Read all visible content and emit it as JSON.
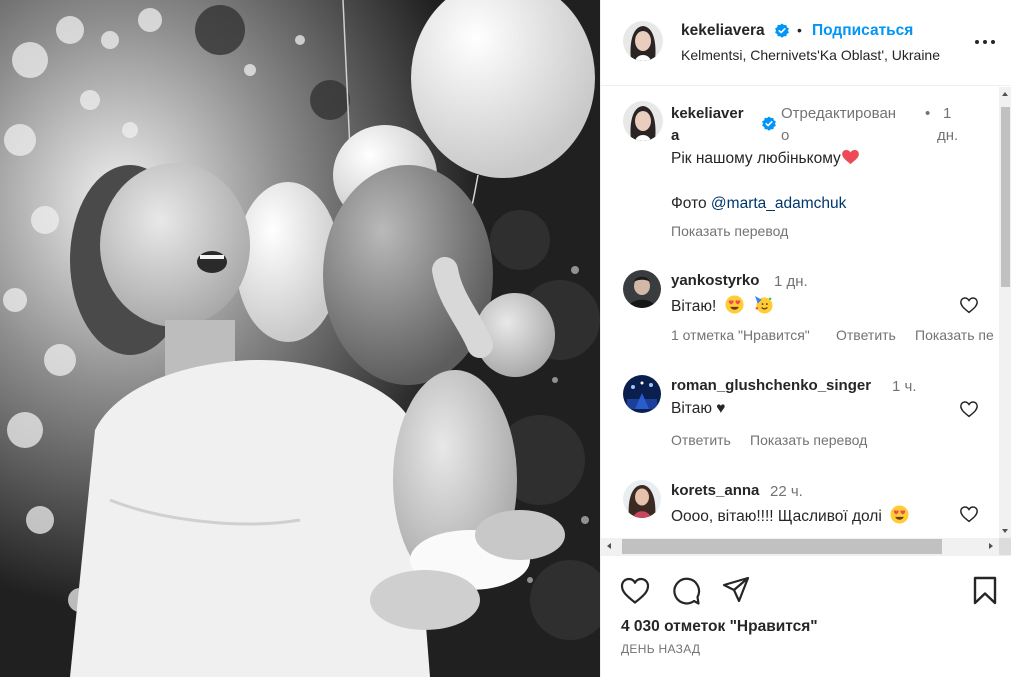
{
  "post": {
    "author": "kekeliavera",
    "follow_label": "Подписаться",
    "separator": "•",
    "location": "Kelmentsi, Chernivets'Ka Oblast', Ukraine",
    "caption": {
      "author_line1": "kekeliaver",
      "author_line2": "a",
      "edited_line1": "Отредактирован",
      "edited_line2": "о",
      "separator": "•",
      "time_line1": "1",
      "time_line2": "дн.",
      "text": "Рік нашому любінькому",
      "photo_prefix": "Фото ",
      "photo_mention": "@marta_adamchuk",
      "translate_label": "Показать перевод"
    }
  },
  "comments": [
    {
      "user": "yankostyrko",
      "time": "1 дн.",
      "text": "Вітаю!",
      "emojis": [
        "smiling-face-with-heart-eyes",
        "partying-face"
      ],
      "likes_label": "1 отметка \"Нравится\"",
      "reply_label": "Ответить",
      "translate_label": "Показать пе"
    },
    {
      "user": "roman_glushchenko_singer",
      "time": "1 ч.",
      "text": "Вітаю ♥",
      "reply_label": "Ответить",
      "translate_label": "Показать перевод"
    },
    {
      "user": "korets_anna",
      "time": "22 ч.",
      "text": "Оооо, вітаю!!!! Щасливої долі",
      "emojis": [
        "smiling-face-with-heart-eyes"
      ]
    }
  ],
  "footer": {
    "likes": "4 030 отметок \"Нравится\"",
    "date": "ДЕНЬ НАЗАД"
  },
  "colors": {
    "accent": "#0095f6",
    "verified": "#0095f6",
    "heart": "#ed4956",
    "text_secondary": "#737373"
  }
}
